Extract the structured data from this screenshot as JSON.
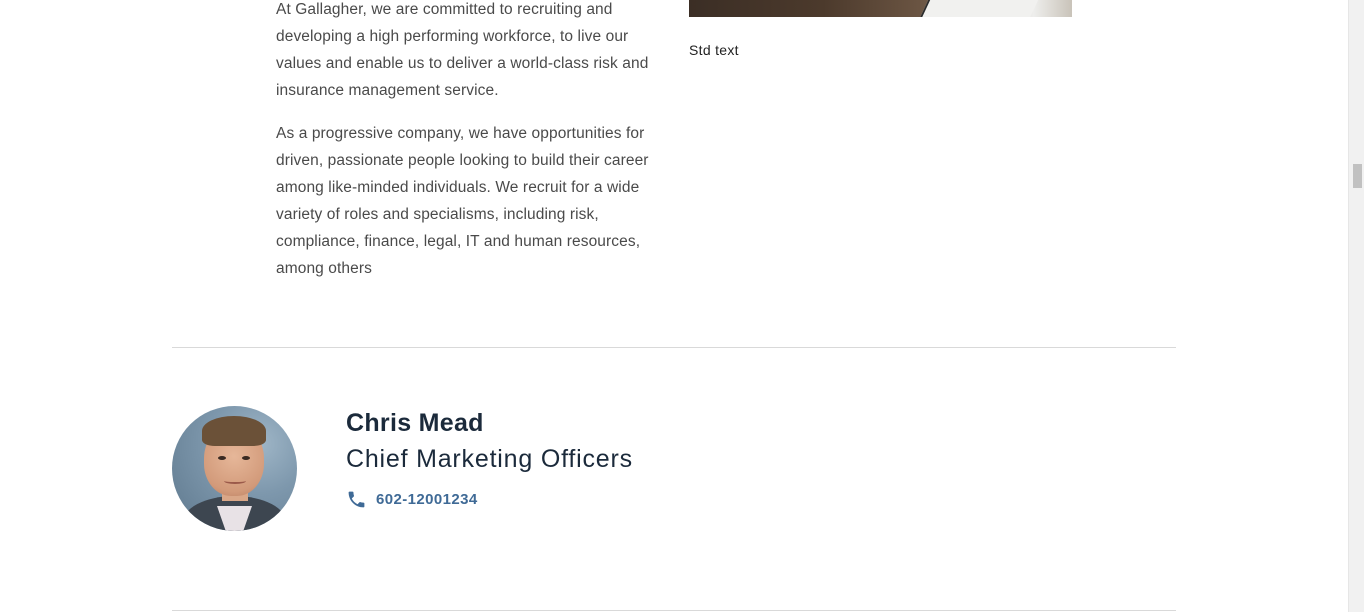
{
  "intro": {
    "paragraph_1": "At Gallagher, we are committed to recruiting and developing a high performing workforce, to live our values and enable us to deliver a world-class risk and insurance management service.",
    "paragraph_2": "As a progressive company, we have opportunities for driven, passionate people looking to build their career among like-minded individuals. We recruit for a wide variety of roles and specialisms, including risk, compliance, finance, legal, IT and human resources, among others"
  },
  "media": {
    "caption": "Std text"
  },
  "contact": {
    "name": "Chris Mead",
    "title": "Chief Marketing Officers",
    "phone": "602-12001234",
    "phone_icon": "phone-icon",
    "accent_color": "#3f6a96",
    "name_color": "#1b2a3b"
  }
}
